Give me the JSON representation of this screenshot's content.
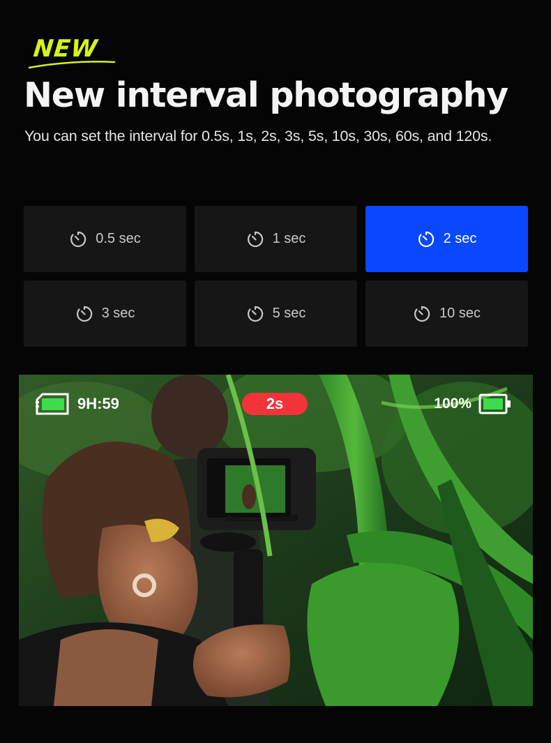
{
  "badge": {
    "label": "NEW",
    "accent": "#d6f21a"
  },
  "header": {
    "title": "New interval photography",
    "subtitle": "You can set the interval for 0.5s, 1s, 2s, 3s, 5s, 10s, 30s, 60s, and 120s."
  },
  "intervals": {
    "icon": "timer-icon",
    "selected_index": 2,
    "active_color": "#0a47ff",
    "options": [
      {
        "label": "0.5 sec"
      },
      {
        "label": "1 sec"
      },
      {
        "label": "2 sec"
      },
      {
        "label": "3 sec"
      },
      {
        "label": "5 sec"
      },
      {
        "label": "10 sec"
      }
    ]
  },
  "camera_preview": {
    "storage_icon": "sd-card-icon",
    "remaining_time": "9H:59",
    "interval_badge": "2s",
    "interval_badge_color": "#f2333a",
    "battery_percent": "100%",
    "battery_icon": "battery-full-icon",
    "battery_color": "#3ddc4a"
  }
}
